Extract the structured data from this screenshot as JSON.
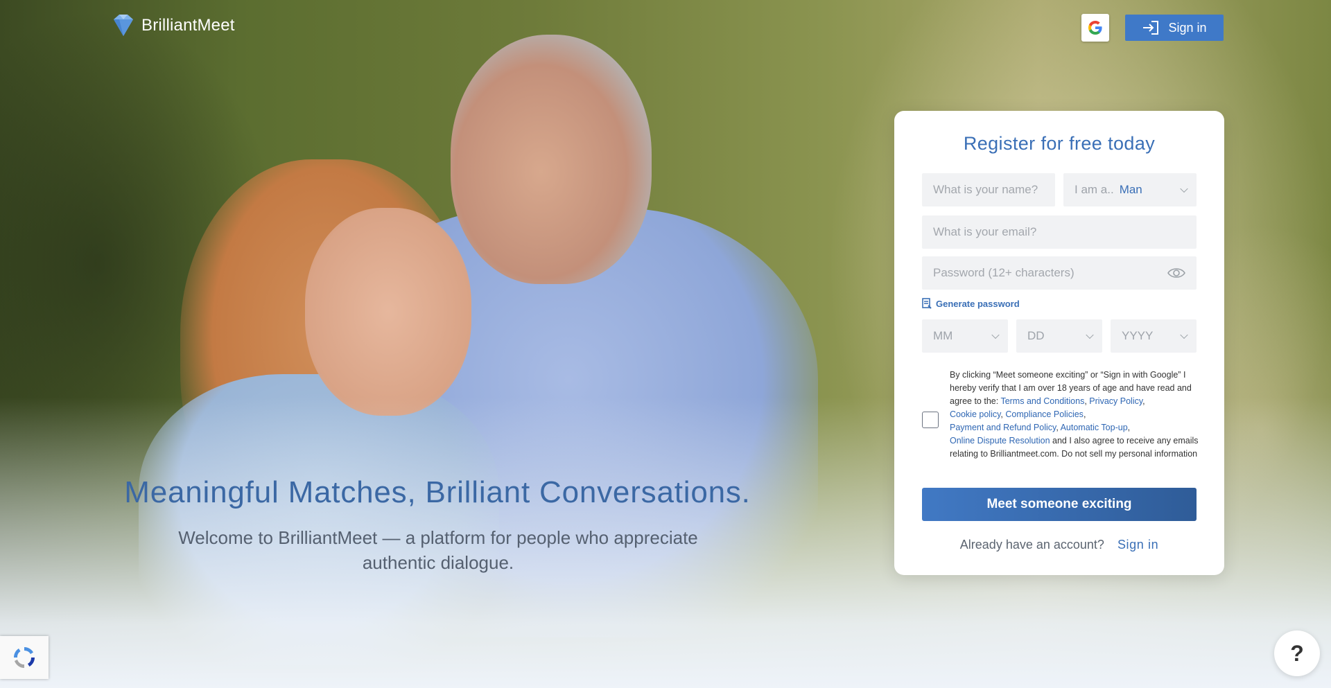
{
  "header": {
    "logo_text": "BrilliantMeet",
    "sign_in_label": "Sign in",
    "google_icon": "google-g-icon"
  },
  "hero": {
    "title": "Meaningful Matches, Brilliant Conversations.",
    "subtitle": "Welcome to BrilliantMeet — a platform for people who appreciate authentic dialogue."
  },
  "form": {
    "title": "Register for free today",
    "name_placeholder": "What is your name?",
    "gender_label": "I am a..",
    "gender_value": "Man",
    "email_placeholder": "What is your email?",
    "password_placeholder": "Password (12+ characters)",
    "generate_password_label": "Generate password",
    "dob_month": "MM",
    "dob_day": "DD",
    "dob_year": "YYYY",
    "terms": {
      "intro": "By clicking “Meet someone exciting” or “Sign in with Google” I hereby verify that I am over 18 years of age and have read and agree to the: ",
      "links": [
        "Terms and Conditions",
        "Privacy Policy",
        "Cookie policy",
        "Compliance Policies",
        "Payment and Refund Policy",
        "Automatic Top-up",
        "Online Dispute Resolution"
      ],
      "outro": " and I also agree to receive any emails relating to Brilliantmeet.com. Do not sell my personal information"
    },
    "submit_label": "Meet someone exciting",
    "already_text": "Already have an account?",
    "sign_in_link": "Sign in"
  },
  "help_label": "?",
  "colors": {
    "brand_blue": "#3a6fb6",
    "button_blue": "#3f79c8",
    "field_bg": "#f1f2f4"
  }
}
